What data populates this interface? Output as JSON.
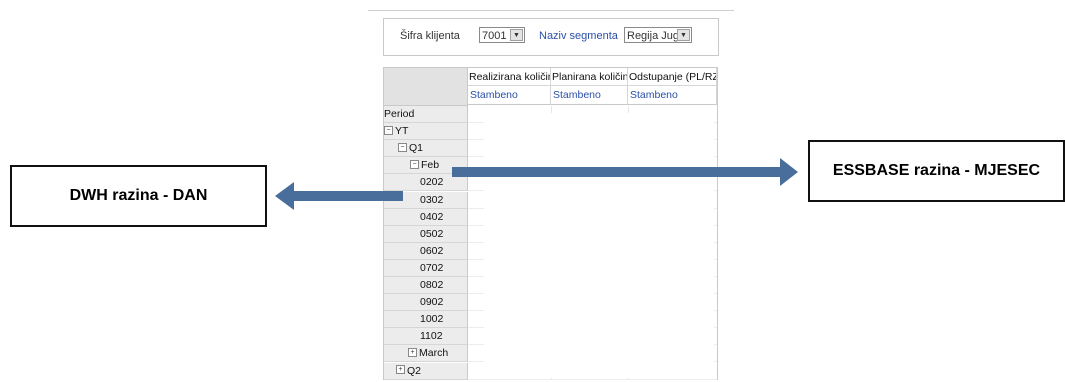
{
  "filters": {
    "client_label": "Šifra klijenta",
    "client_value": "7001",
    "segment_label": "Naziv segmenta",
    "segment_value": "Regija Jug"
  },
  "columns": [
    {
      "header": "Realizirana količina",
      "sub": "Stambeno"
    },
    {
      "header": "Planirana količina",
      "sub": "Stambeno"
    },
    {
      "header": "Odstupanje (PL/RZ)",
      "sub": "Stambeno"
    }
  ],
  "rows": [
    {
      "label": "Period",
      "toggle": ""
    },
    {
      "label": "YT",
      "toggle": "−"
    },
    {
      "label": "Q1",
      "toggle": "−"
    },
    {
      "label": "Feb",
      "toggle": "−"
    },
    {
      "label": "0202",
      "toggle": ""
    },
    {
      "label": "0302",
      "toggle": ""
    },
    {
      "label": "0402",
      "toggle": ""
    },
    {
      "label": "0502",
      "toggle": ""
    },
    {
      "label": "0602",
      "toggle": ""
    },
    {
      "label": "0702",
      "toggle": ""
    },
    {
      "label": "0802",
      "toggle": ""
    },
    {
      "label": "0902",
      "toggle": ""
    },
    {
      "label": "1002",
      "toggle": ""
    },
    {
      "label": "1102",
      "toggle": ""
    },
    {
      "label": "March",
      "toggle": "+"
    },
    {
      "label": "Q2",
      "toggle": "+"
    }
  ],
  "callouts": {
    "left": "DWH razina - DAN",
    "right": "ESSBASE razina - MJESEC"
  },
  "colors": {
    "arrow": "#4a6e9c",
    "link_blue": "#2a4fa8"
  },
  "icons": {
    "dropdown": "chevron-down-icon",
    "collapse": "minus-box-icon",
    "expand": "plus-box-icon"
  }
}
